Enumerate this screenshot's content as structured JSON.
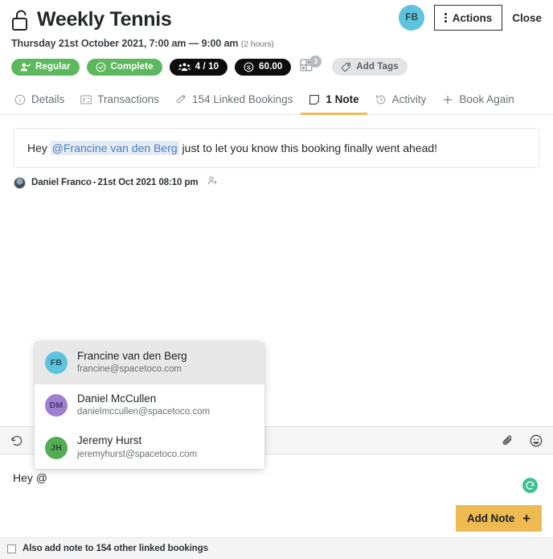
{
  "header": {
    "lock_icon": "unlocked-padlock-icon",
    "title": "Weekly Tennis",
    "subtitle": "Thursday 21st October 2021, 7:00 am — 9:00 am",
    "duration": "(2 hours)",
    "avatar_initials": "FB",
    "avatar_color": "#5ec3dd",
    "actions_label": "Actions",
    "close_label": "Close"
  },
  "pills": [
    {
      "label": "Regular",
      "style": "green",
      "icon": "user-check-icon"
    },
    {
      "label": "Complete",
      "style": "green",
      "icon": "check-circle-icon"
    },
    {
      "label": "4 / 10",
      "style": "dark",
      "icon": "people-icon"
    },
    {
      "label": "60.00",
      "style": "dark",
      "icon": "dollar-circle-icon"
    }
  ],
  "resources": {
    "icon": "resources-grid-icon",
    "count": "3"
  },
  "add_tags": {
    "label": "Add Tags",
    "icon": "tag-icon"
  },
  "tabs": [
    {
      "label": "Details",
      "icon": "info-circle-icon",
      "active": false
    },
    {
      "label": "Transactions",
      "icon": "card-icon",
      "active": false
    },
    {
      "label": "154 Linked Bookings",
      "icon": "link-icon",
      "active": false
    },
    {
      "label": "1 Note",
      "icon": "note-icon",
      "active": true
    },
    {
      "label": "Activity",
      "icon": "history-icon",
      "active": false
    },
    {
      "label": "Book Again",
      "icon": "plus-icon",
      "active": false
    }
  ],
  "note": {
    "text_before": "Hey ",
    "mention": "@Francine van den Berg",
    "text_after": " just to let you know this booking finally went ahead!",
    "author": "Daniel Franco",
    "separator": " - ",
    "timestamp": "21st Oct 2021 08:10 pm",
    "add_person_icon": "person-add-icon"
  },
  "mention_menu": {
    "items": [
      {
        "initials": "FB",
        "name": "Francine van den Berg",
        "email": "francine@spacetoco.com",
        "color": "#5ec3dd",
        "selected": true
      },
      {
        "initials": "DM",
        "name": "Daniel McCullen",
        "email": "danielmccullen@spacetoco.com",
        "color": "#a07fd0",
        "selected": false
      },
      {
        "initials": "JH",
        "name": "Jeremy Hurst",
        "email": "jeremyhurst@spacetoco.com",
        "color": "#55aa55",
        "selected": false
      }
    ]
  },
  "editor": {
    "undo_icon": "undo-icon",
    "attach_icon": "paperclip-icon",
    "emoji_icon": "emoji-icon",
    "value": "Hey @",
    "grammarly_icon": "grammarly-icon",
    "grammarly_color": "#3ec295"
  },
  "footer": {
    "add_note_label": "Add Note",
    "add_note_plus": "+",
    "add_note_color": "#eeba52",
    "checkbox_checked": false,
    "checkbox_label": "Also add note to 154 other linked bookings"
  }
}
